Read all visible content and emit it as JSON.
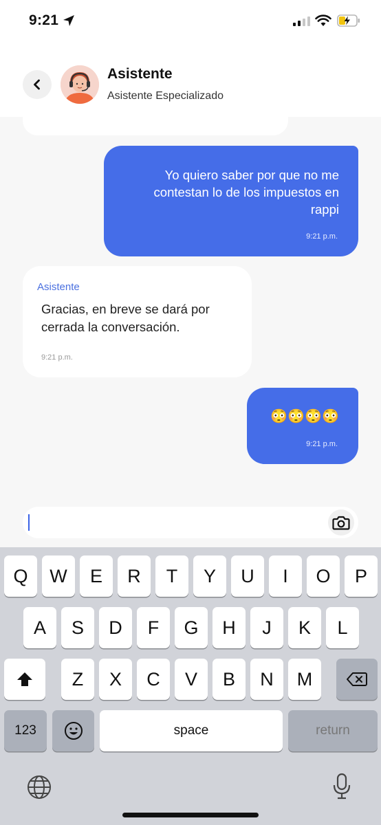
{
  "status_bar": {
    "time": "9:21",
    "location_icon": "location-arrow-icon",
    "signal_icon": "cellular-signal-icon",
    "wifi_icon": "wifi-icon",
    "battery_icon": "battery-charging-icon"
  },
  "header": {
    "back_icon": "chevron-left-icon",
    "title": "Asistente",
    "subtitle": "Asistente Especializado",
    "avatar_icon": "agent-avatar"
  },
  "chat": {
    "messages": [
      {
        "direction": "outgoing",
        "lines": [
          "Yo quiero saber por que no me",
          "contestan lo de los impuestos en",
          "rappi"
        ],
        "time": "9:21 p.m."
      },
      {
        "direction": "incoming",
        "sender": "Asistente",
        "lines": [
          "Gracias, en breve se dará por",
          "cerrada la conversación."
        ],
        "time": "9:21 p.m."
      },
      {
        "direction": "outgoing",
        "text": "😳😳😳😳",
        "time": "9:21 p.m."
      }
    ]
  },
  "composer": {
    "value": "",
    "camera_icon": "camera-icon"
  },
  "keyboard": {
    "row1": [
      "Q",
      "W",
      "E",
      "R",
      "T",
      "Y",
      "U",
      "I",
      "O",
      "P"
    ],
    "row2": [
      "A",
      "S",
      "D",
      "F",
      "G",
      "H",
      "J",
      "K",
      "L"
    ],
    "row3": [
      "Z",
      "X",
      "C",
      "V",
      "B",
      "N",
      "M"
    ],
    "numbers_label": "123",
    "space_label": "space",
    "return_label": "return",
    "shift_icon": "shift-icon",
    "delete_icon": "backspace-icon",
    "emoji_icon": "emoji-icon",
    "globe_icon": "globe-icon",
    "mic_icon": "microphone-icon"
  },
  "colors": {
    "accent": "#456de8",
    "chat_background": "#f7f7f7",
    "keyboard_background": "#d1d3d9"
  }
}
